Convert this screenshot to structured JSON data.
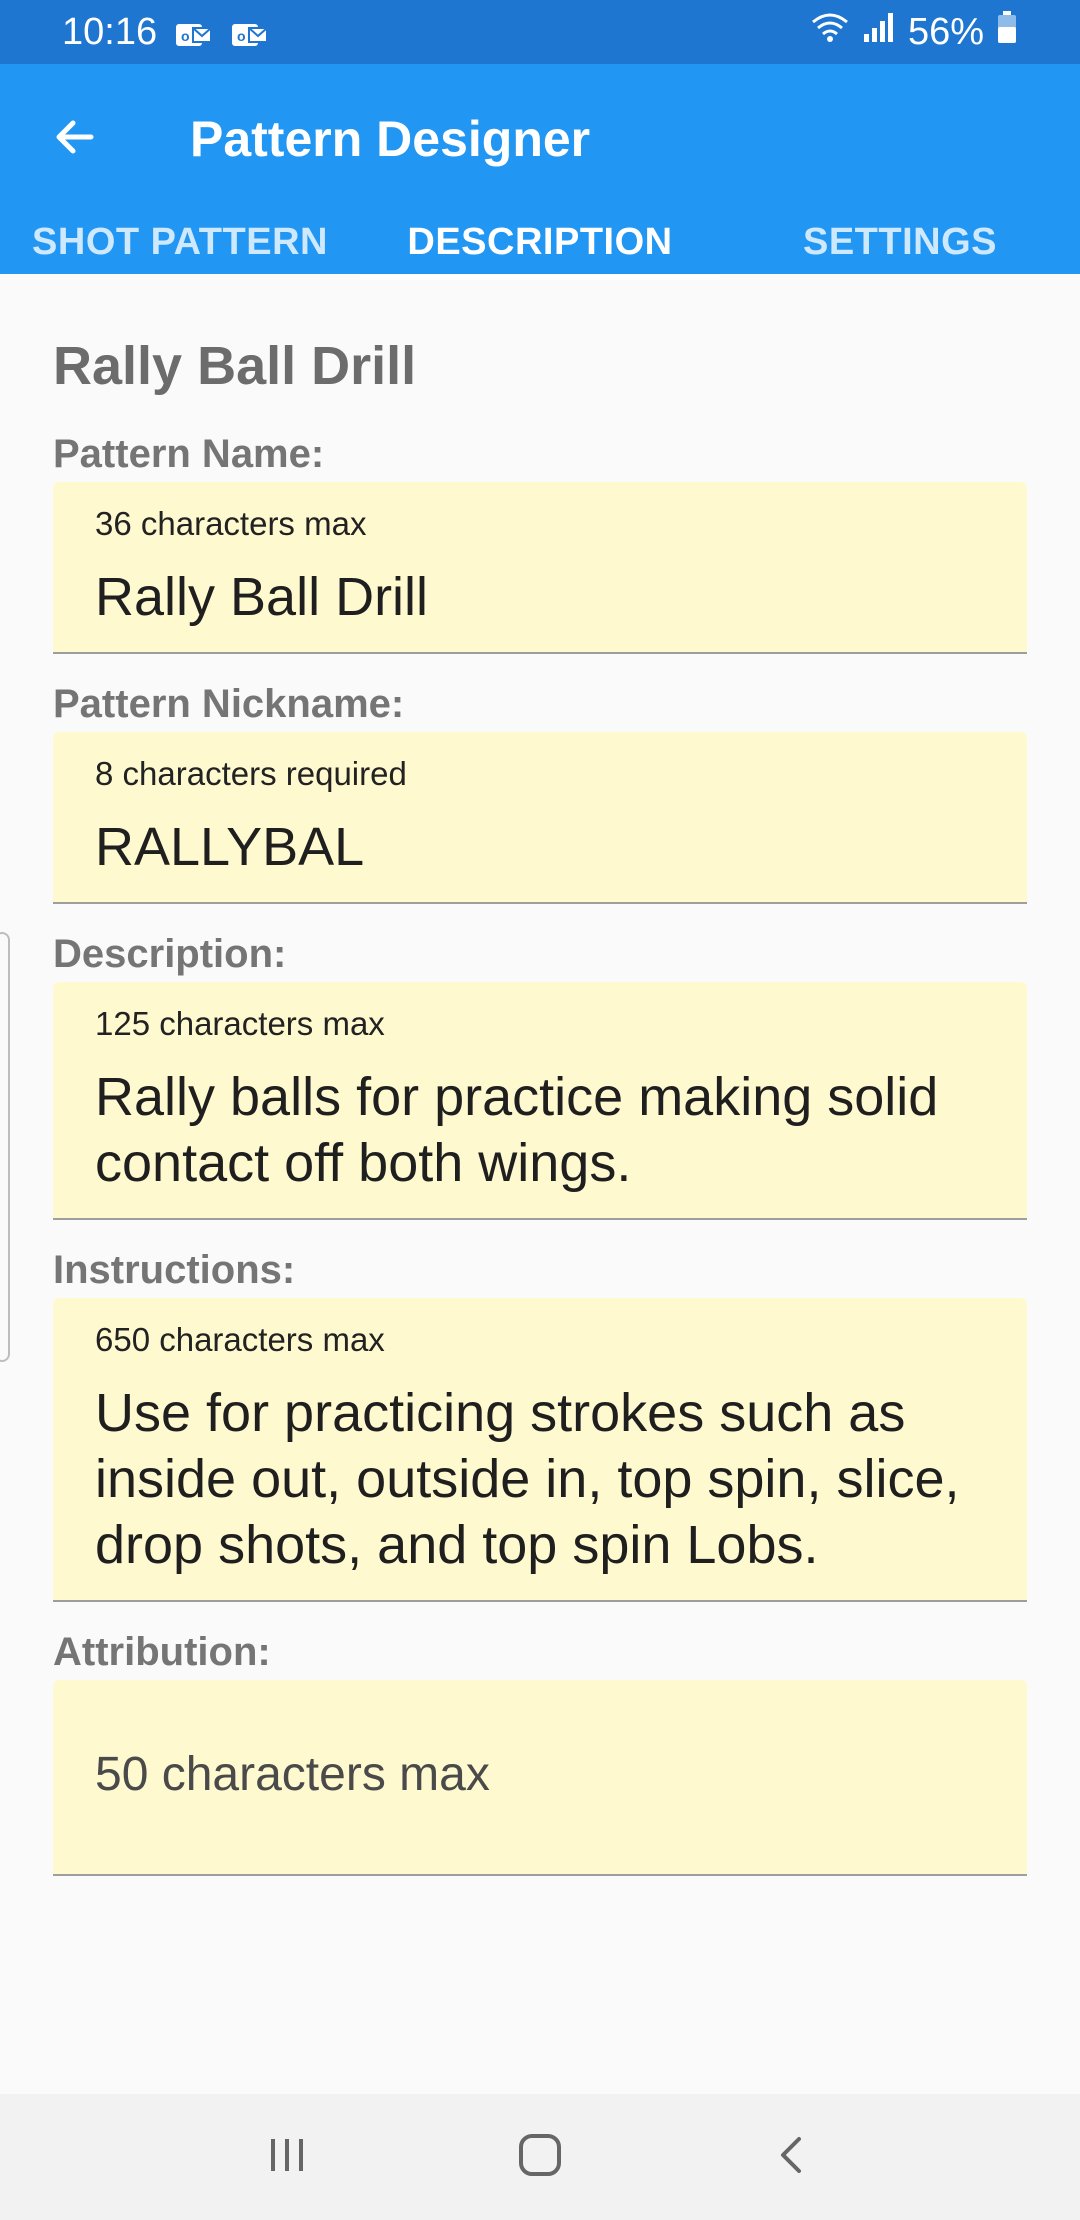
{
  "status_bar": {
    "time": "10:16",
    "battery_percent": "56%",
    "icons": [
      "mail-notification-icon",
      "mail-notification-icon",
      "wifi-icon",
      "signal-icon",
      "battery-icon"
    ]
  },
  "app_bar": {
    "title": "Pattern Designer",
    "back_icon": "arrow-left-icon",
    "background_color": "#2196f3"
  },
  "tabs": [
    {
      "label": "SHOT PATTERN",
      "active": false
    },
    {
      "label": "DESCRIPTION",
      "active": true
    },
    {
      "label": "SETTINGS",
      "active": false
    }
  ],
  "content": {
    "heading": "Rally Ball Drill",
    "fields": [
      {
        "label": "Pattern Name:",
        "hint": "36 characters max",
        "value": "Rally Ball Drill"
      },
      {
        "label": "Pattern Nickname:",
        "hint": "8 characters required",
        "value": "RALLYBAL"
      },
      {
        "label": "Description:",
        "hint": "125 characters max",
        "value": "Rally balls for practice making solid contact off both wings."
      },
      {
        "label": "Instructions:",
        "hint": "650 characters max",
        "value": "Use for practicing strokes such as inside out, outside in, top spin, slice, drop shots, and top spin Lobs."
      },
      {
        "label": "Attribution:",
        "placeholder": "50 characters max",
        "value": ""
      }
    ],
    "field_background": "#fff9cf"
  },
  "nav_bar": {
    "icons": [
      "recent-apps-icon",
      "home-icon",
      "back-icon"
    ]
  }
}
